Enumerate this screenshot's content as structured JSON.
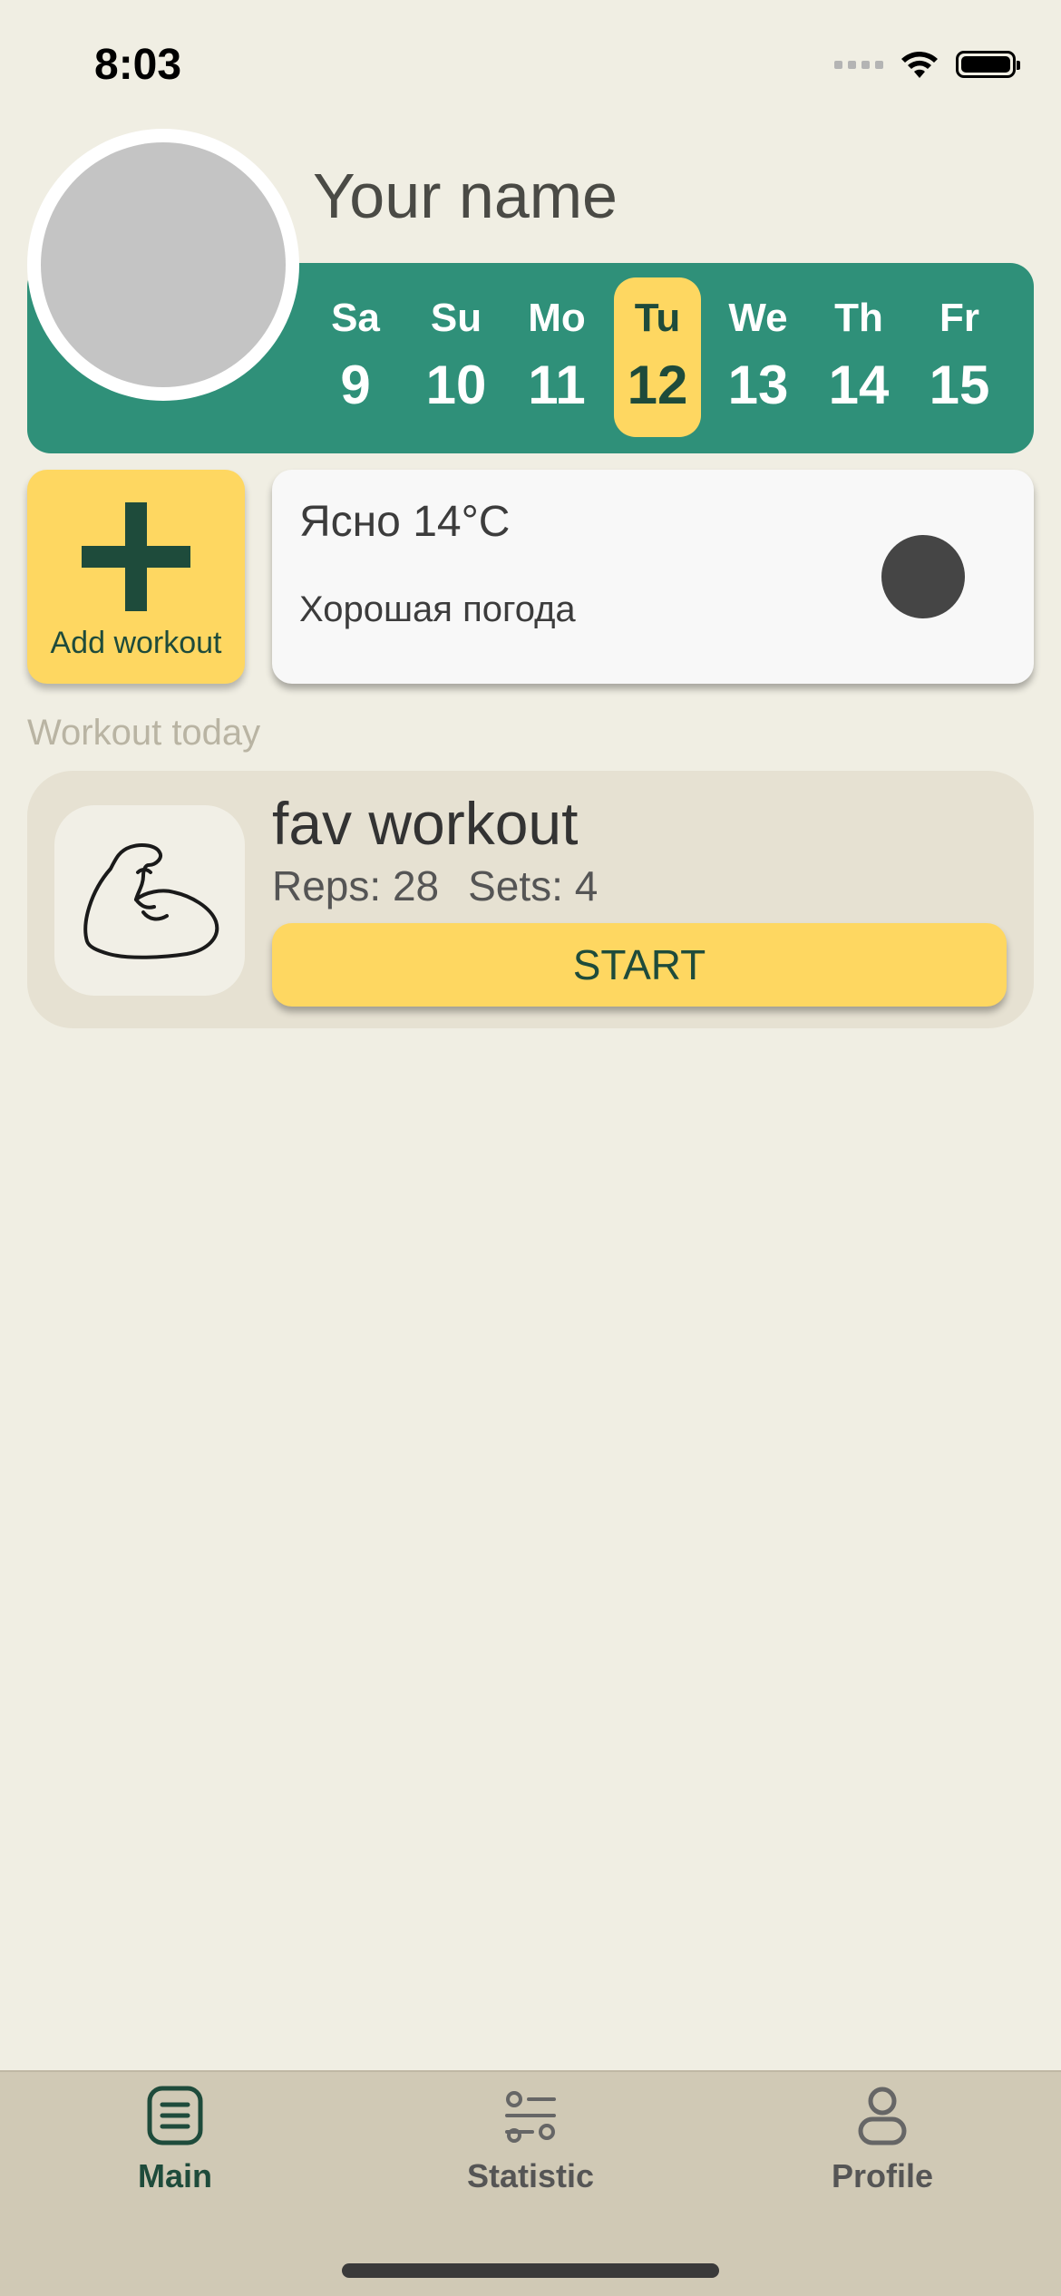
{
  "status_bar": {
    "time": "8:03"
  },
  "profile": {
    "name": "Your name"
  },
  "calendar": {
    "days": [
      {
        "name": "Sa",
        "number": "9",
        "active": false
      },
      {
        "name": "Su",
        "number": "10",
        "active": false
      },
      {
        "name": "Mo",
        "number": "11",
        "active": false
      },
      {
        "name": "Tu",
        "number": "12",
        "active": true
      },
      {
        "name": "We",
        "number": "13",
        "active": false
      },
      {
        "name": "Th",
        "number": "14",
        "active": false
      },
      {
        "name": "Fr",
        "number": "15",
        "active": false
      }
    ]
  },
  "add_workout": {
    "label": "Add workout",
    "icon": "plus-icon"
  },
  "weather": {
    "title": "Ясно 14°C",
    "description": "Хорошая погода",
    "icon": "weather-icon"
  },
  "workouts_section": {
    "title": "Workout today",
    "items": [
      {
        "name": "fav workout",
        "reps": "Reps: 28",
        "sets": "Sets: 4",
        "start_label": "START",
        "icon": "bicep-icon"
      }
    ]
  },
  "tabbar": {
    "tabs": [
      {
        "label": "Main",
        "icon": "list-icon",
        "active": true
      },
      {
        "label": "Statistic",
        "icon": "sliders-icon",
        "active": false
      },
      {
        "label": "Profile",
        "icon": "person-icon",
        "active": false
      }
    ]
  },
  "colors": {
    "background": "#F0EEE3",
    "accent_green": "#2F9079",
    "accent_yellow": "#FED761",
    "dark_green": "#1E4B3B",
    "tabbar": "#D0C9B5"
  }
}
